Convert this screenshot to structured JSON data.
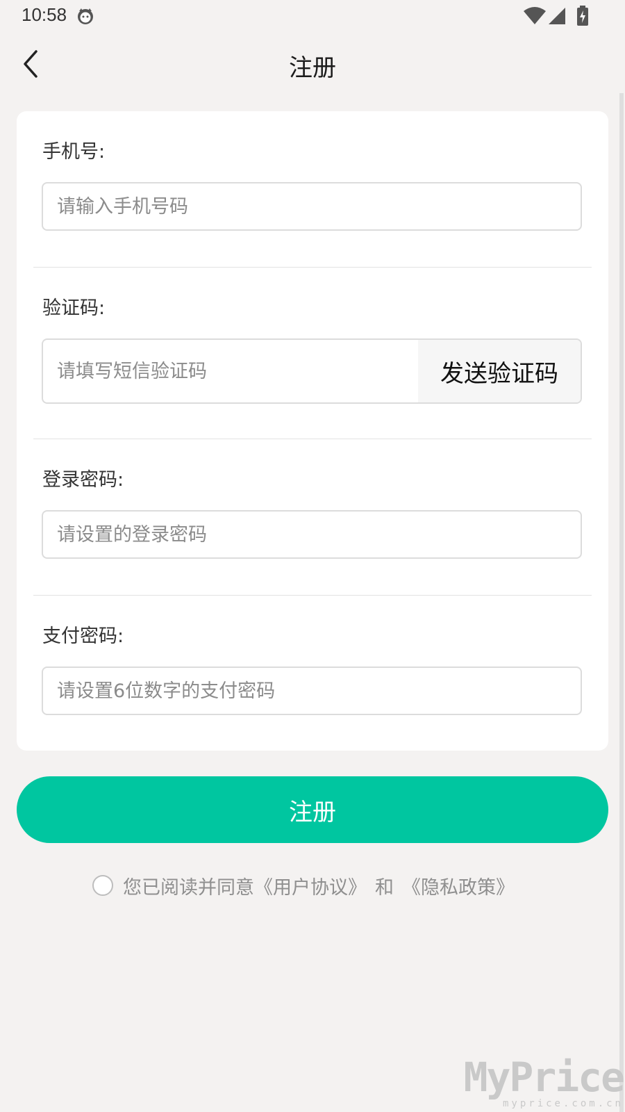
{
  "status_bar": {
    "time": "10:58",
    "icons": [
      "cat-icon",
      "wifi-icon",
      "signal-icon",
      "battery-charging-icon"
    ]
  },
  "header": {
    "title": "注册",
    "back_icon": "chevron-left-icon"
  },
  "form": {
    "phone": {
      "label": "手机号:",
      "placeholder": "请输入手机号码"
    },
    "code": {
      "label": "验证码:",
      "placeholder": "请填写短信验证码",
      "send_button": "发送验证码"
    },
    "login_password": {
      "label": "登录密码:",
      "placeholder": "请设置的登录密码"
    },
    "pay_password": {
      "label": "支付密码:",
      "placeholder": "请设置6位数字的支付密码"
    }
  },
  "register_button": "注册",
  "agreement": {
    "prefix": "您已阅读并同意",
    "user_agreement": "《用户协议》",
    "and": "和",
    "privacy_policy": "《隐私政策》",
    "checked": false
  },
  "colors": {
    "accent": "#00c6a0",
    "background": "#f4f2f1",
    "card": "#ffffff"
  },
  "watermark": {
    "main": "MyPrice",
    "sub": "myprice.com.cn"
  }
}
